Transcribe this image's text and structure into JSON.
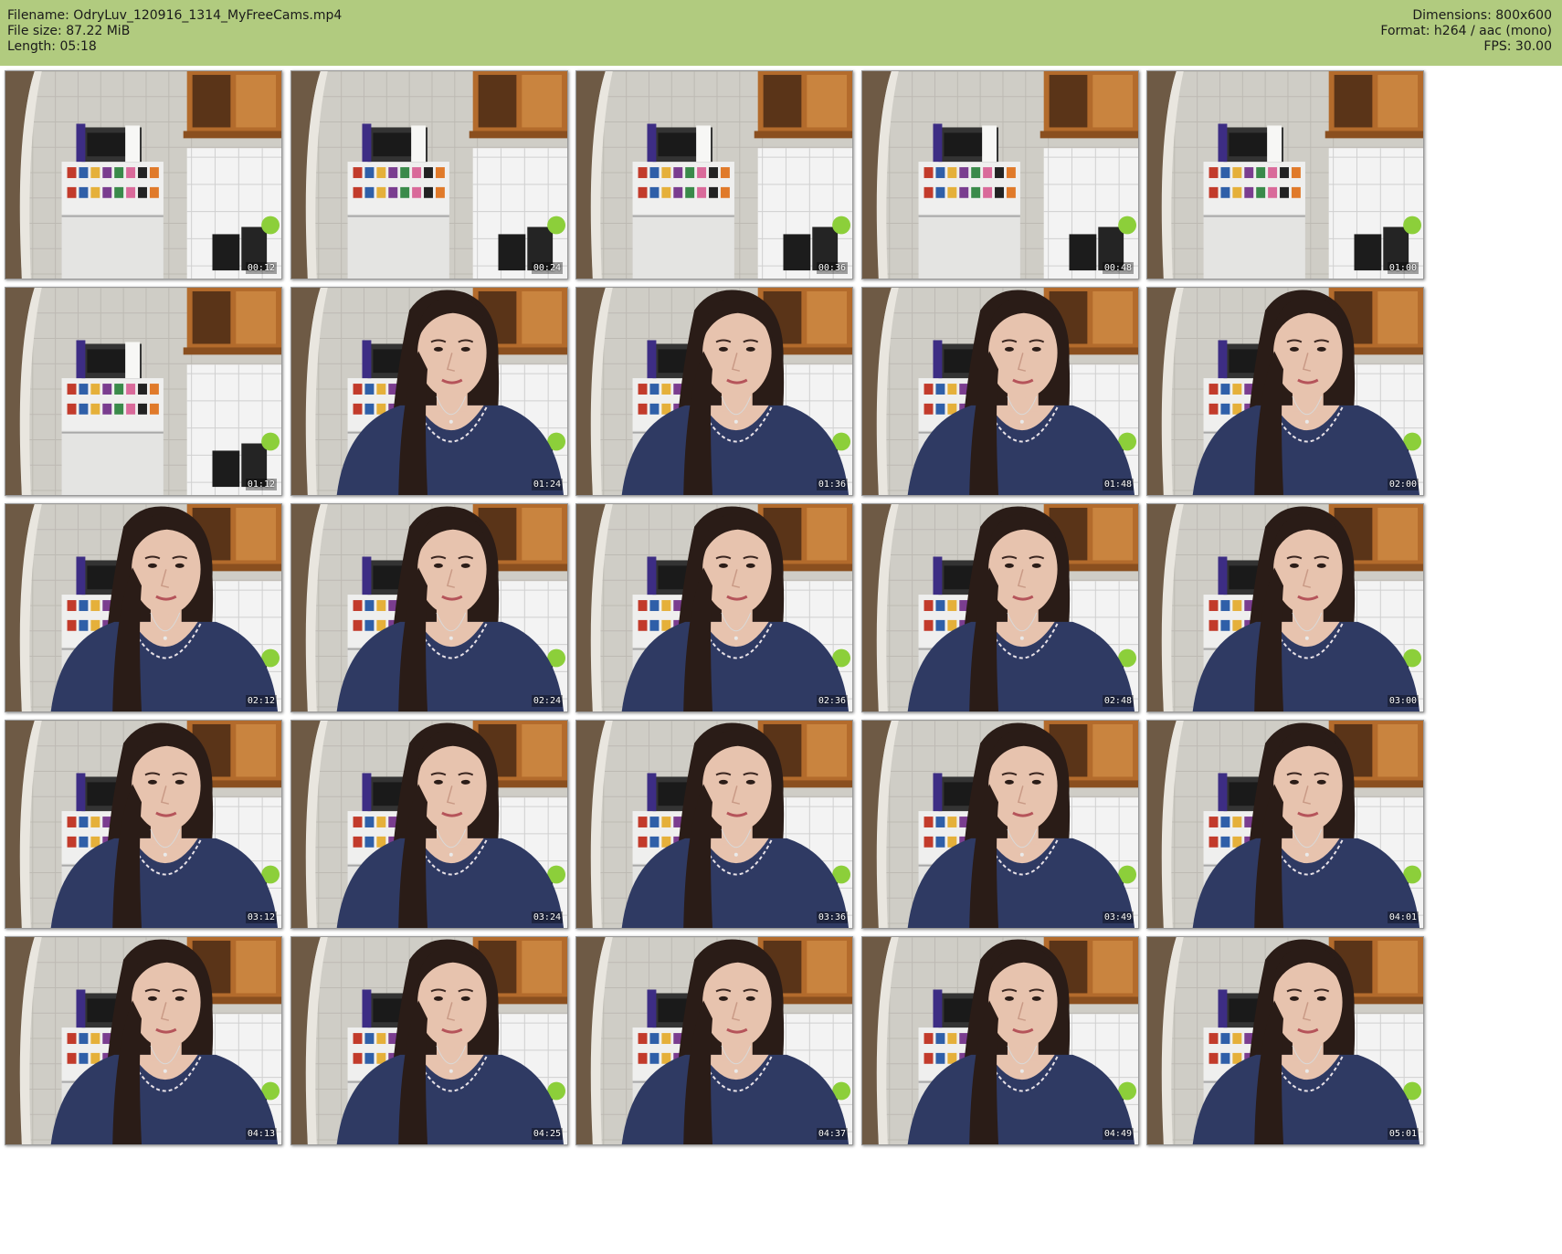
{
  "header": {
    "filename_line": "Filename: OdryLuv_120916_1314_MyFreeCams.mp4",
    "filesize_line": "File size: 87.22 MiB",
    "length_line": "Length: 05:18",
    "dimensions_line": "Dimensions: 800x600",
    "format_line": "Format: h264 / aac (mono)",
    "fps_line": "FPS: 30.00"
  },
  "colors": {
    "header_bg": "#b1cb7f",
    "robe": "#2f3a63",
    "hair": "#2a1c17",
    "skin": "#e7c3ae",
    "cabinet": "#b36b2c",
    "wall": "#cfcdc6"
  },
  "frames": [
    {
      "time": "00:12",
      "person": false
    },
    {
      "time": "00:24",
      "person": false
    },
    {
      "time": "00:36",
      "person": false
    },
    {
      "time": "00:48",
      "person": false
    },
    {
      "time": "01:00",
      "person": false
    },
    {
      "time": "01:12",
      "person": false
    },
    {
      "time": "01:24",
      "person": true
    },
    {
      "time": "01:36",
      "person": true
    },
    {
      "time": "01:48",
      "person": true
    },
    {
      "time": "02:00",
      "person": true
    },
    {
      "time": "02:12",
      "person": true
    },
    {
      "time": "02:24",
      "person": true
    },
    {
      "time": "02:36",
      "person": true
    },
    {
      "time": "02:48",
      "person": true
    },
    {
      "time": "03:00",
      "person": true
    },
    {
      "time": "03:12",
      "person": true
    },
    {
      "time": "03:24",
      "person": true
    },
    {
      "time": "03:36",
      "person": true
    },
    {
      "time": "03:49",
      "person": true
    },
    {
      "time": "04:01",
      "person": true
    },
    {
      "time": "04:13",
      "person": true
    },
    {
      "time": "04:25",
      "person": true
    },
    {
      "time": "04:37",
      "person": true
    },
    {
      "time": "04:49",
      "person": true
    },
    {
      "time": "05:01",
      "person": true
    }
  ]
}
